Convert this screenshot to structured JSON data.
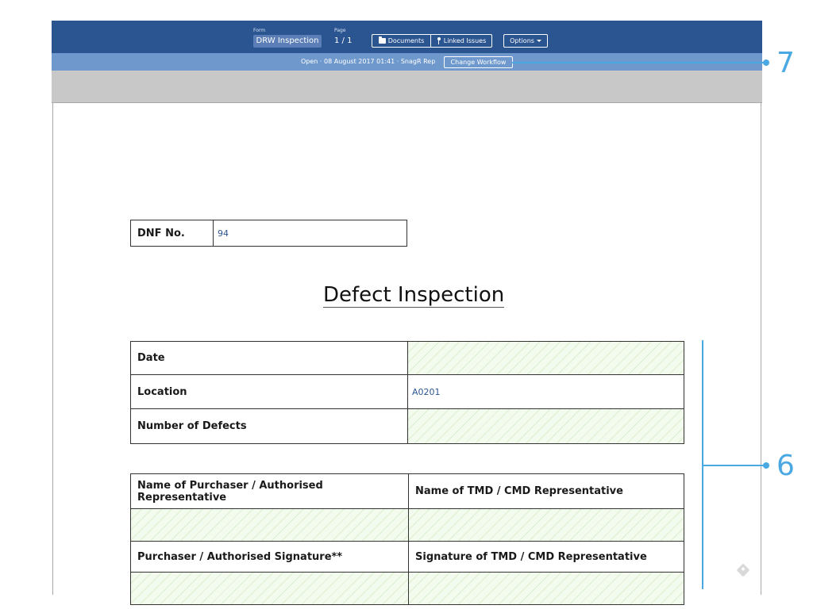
{
  "toolbar": {
    "form_label": "Form",
    "form_name": "DRW Inspection",
    "page_label": "Page",
    "page_value": "1  /  1",
    "documents_label": "Documents",
    "linked_issues_label": "Linked Issues",
    "options_label": "Options",
    "icons": {
      "documents": "folder-icon",
      "linked_issues": "pin-icon",
      "options": "caret-down-icon"
    }
  },
  "status": {
    "text": "Open  ·  08 August 2017 01:41  ·  SnagR Rep",
    "change_workflow_label": "Change Workflow"
  },
  "document": {
    "dnf": {
      "label": "DNF No.",
      "value": "94"
    },
    "title": "Defect Inspection",
    "details": [
      {
        "label": "Date",
        "value": ""
      },
      {
        "label": "Location",
        "value": "A0201"
      },
      {
        "label": "Number of Defects",
        "value": ""
      }
    ],
    "signatures": {
      "header_1": [
        "Name of Purchaser / Authorised Representative",
        "Name of TMD / CMD Representative"
      ],
      "header_2": [
        "Purchaser / Authorised Signature**",
        "Signature of TMD / CMD Representative"
      ]
    }
  },
  "annotations": [
    {
      "number": "7"
    },
    {
      "number": "6"
    }
  ],
  "colors": {
    "toolbar": "#2b5591",
    "status_bar": "#6f99cd",
    "annotation": "#4aa9e2",
    "field_value": "#2b5591"
  }
}
